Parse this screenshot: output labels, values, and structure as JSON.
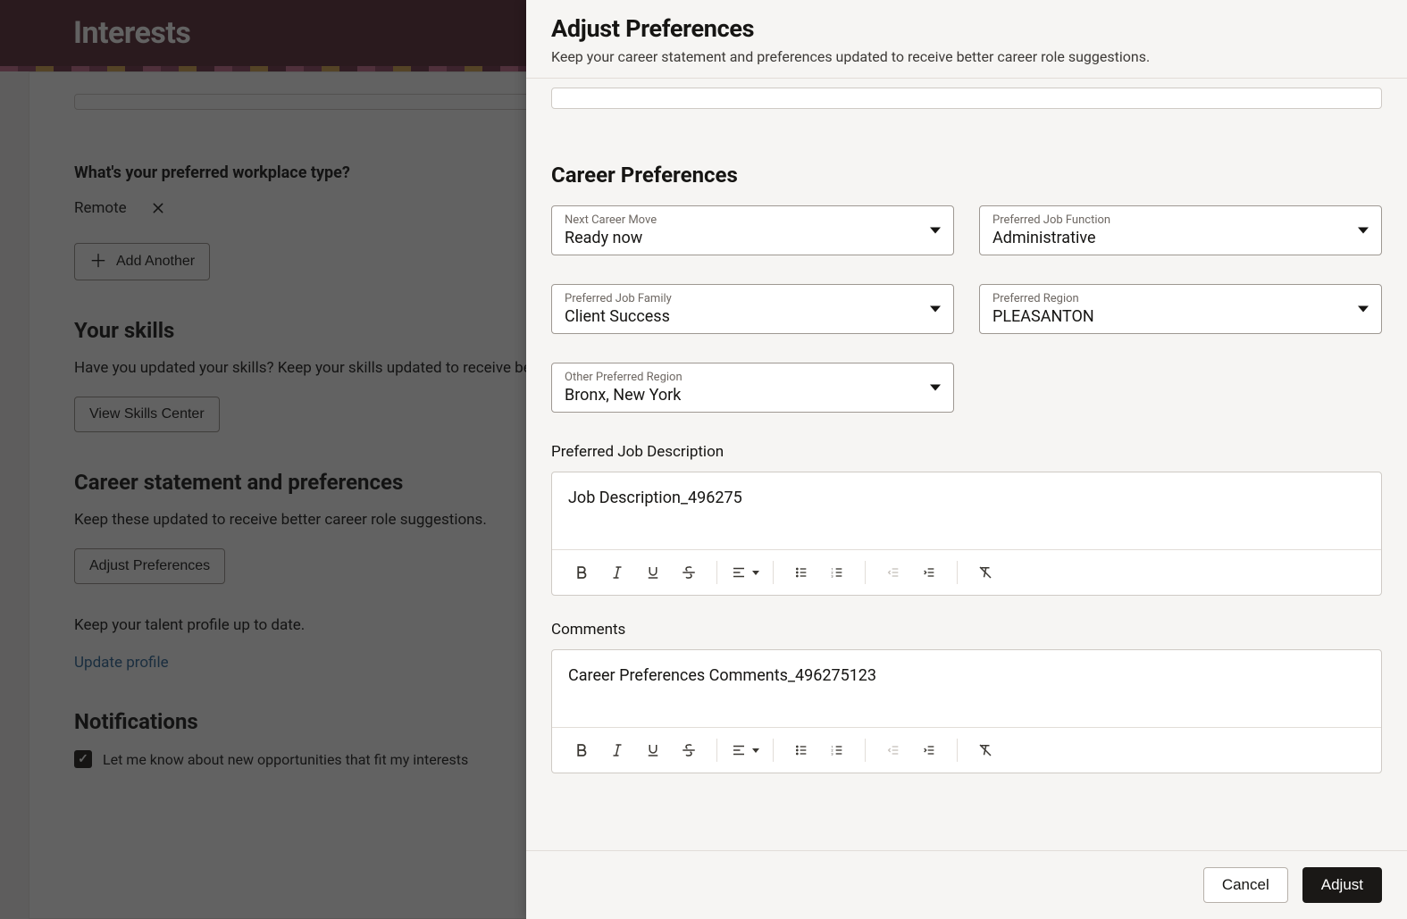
{
  "background": {
    "page_title": "Interests",
    "workplace_question": "What's your preferred workplace type?",
    "workplace_chip": "Remote",
    "add_another_label": "Add Another",
    "skills_heading": "Your skills",
    "skills_text": "Have you updated your skills? Keep your skills updated to receive better r",
    "view_skills_label": "View Skills Center",
    "career_heading": "Career statement and preferences",
    "career_text": "Keep these updated to receive better career role suggestions.",
    "adjust_pref_label": "Adjust Preferences",
    "talent_text": "Keep your talent profile up to date.",
    "update_profile_link": "Update profile",
    "notifications_heading": "Notifications",
    "notify_checkbox_label": "Let me know about new opportunities that fit my interests"
  },
  "panel": {
    "title": "Adjust Preferences",
    "subtitle": "Keep your career statement and preferences updated to receive better career role suggestions.",
    "career_prefs_heading": "Career Preferences",
    "selects": {
      "next_move": {
        "label": "Next Career Move",
        "value": "Ready now"
      },
      "job_function": {
        "label": "Preferred Job Function",
        "value": "Administrative"
      },
      "job_family": {
        "label": "Preferred Job Family",
        "value": "Client Success"
      },
      "region": {
        "label": "Preferred Region",
        "value": "PLEASANTON"
      },
      "other_region": {
        "label": "Other Preferred Region",
        "value": "Bronx, New York"
      }
    },
    "desc_label": "Preferred Job Description",
    "desc_value": "Job Description_496275",
    "comments_label": "Comments",
    "comments_value": "Career Preferences Comments_496275123",
    "cancel_label": "Cancel",
    "adjust_label": "Adjust"
  }
}
